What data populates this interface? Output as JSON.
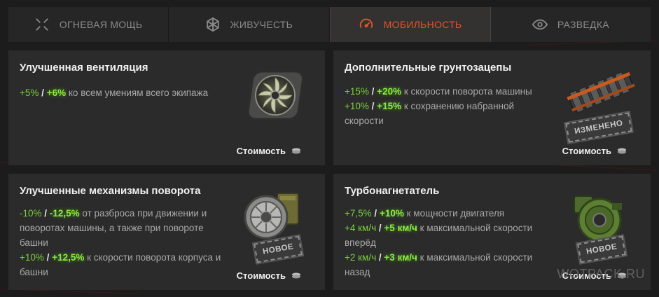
{
  "tabs": [
    {
      "label": "ОГНЕВАЯ МОЩЬ",
      "icon": "crosshair-icon",
      "active": false
    },
    {
      "label": "ЖИВУЧЕСТЬ",
      "icon": "shield-hex-icon",
      "active": false
    },
    {
      "label": "МОБИЛЬНОСТЬ",
      "icon": "speedometer-icon",
      "active": true
    },
    {
      "label": "РАЗВЕДКА",
      "icon": "eye-icon",
      "active": false
    }
  ],
  "colors": {
    "accent": "#e8532a",
    "bonus": "#7bd13a",
    "bonus_bright": "#8aee3c"
  },
  "cards": [
    {
      "title": "Улучшенная вентиляция",
      "image": "ventilation-fan-icon",
      "lines": [
        {
          "v1": "+5%",
          "sep": "/",
          "v2": "+6%",
          "text": "ко всем умениям всего экипажа"
        }
      ],
      "badge": "",
      "cost": "Стоимость"
    },
    {
      "title": "Дополнительные грунтозацепы",
      "image": "track-grousers-icon",
      "lines": [
        {
          "v1": "+15%",
          "sep": "/",
          "v2": "+20%",
          "text": "к скорости поворота машины"
        },
        {
          "v1": "+10%",
          "sep": "/",
          "v2": "+15%",
          "text": "к сохранению набранной скорости"
        }
      ],
      "badge": "ИЗМЕНЕНО",
      "cost": "Стоимость"
    },
    {
      "title": "Улучшенные механизмы поворота",
      "image": "turning-mechanism-icon",
      "lines": [
        {
          "v1": "-10%",
          "sep": "/",
          "v2": "-12,5%",
          "text": "от разброса при движении и поворотах машины, а также при повороте башни"
        },
        {
          "v1": "+10%",
          "sep": "/",
          "v2": "+12,5%",
          "text": "к скорости поворота корпуса и башни"
        }
      ],
      "badge": "НОВОЕ",
      "cost": "Стоимость"
    },
    {
      "title": "Турбонагнетатель",
      "image": "turbocharger-icon",
      "lines": [
        {
          "v1": "+7,5%",
          "sep": "/",
          "v2": "+10%",
          "text": "к мощности двигателя"
        },
        {
          "v1": "+4 км/ч",
          "sep": "/",
          "v2": "+5 км/ч",
          "text": "к максимальной скорости вперёд"
        },
        {
          "v1": "+2 км/ч",
          "sep": "/",
          "v2": "+3 км/ч",
          "text": "к максимальной скорости назад"
        }
      ],
      "badge": "НОВОЕ",
      "cost": "Стоимость"
    }
  ],
  "watermark": "WOTPACK.RU"
}
